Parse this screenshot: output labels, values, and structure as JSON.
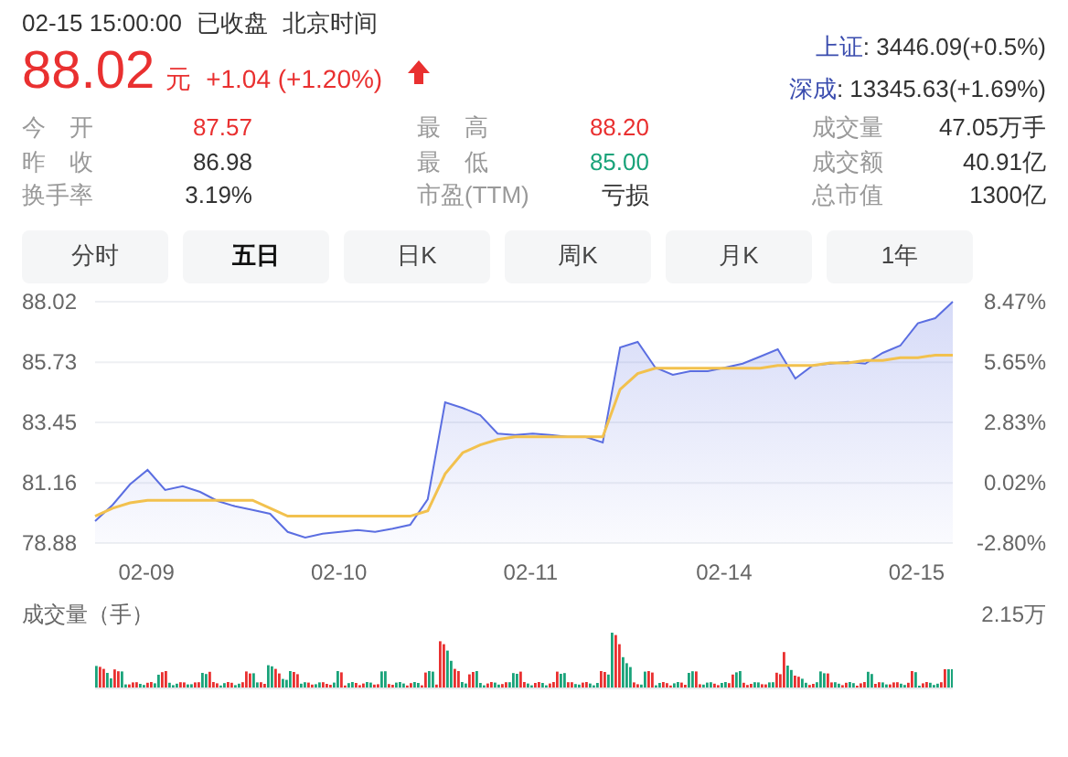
{
  "header": {
    "datetime": "02-15 15:00:00",
    "status": "已收盘",
    "timezone": "北京时间"
  },
  "price": {
    "value": "88.02",
    "unit": "元",
    "change": "+1.04 (+1.20%)",
    "rising": true
  },
  "indices": [
    {
      "name": "上证",
      "value": ": 3446.09(+0.5%)"
    },
    {
      "name": "深成",
      "value": ": 13345.63(+1.69%)"
    }
  ],
  "stats": [
    {
      "label": "今　开",
      "value": "87.57",
      "color": "#e93030"
    },
    {
      "label": "最　高",
      "value": "88.20",
      "color": "#e93030"
    },
    {
      "label": "成交量",
      "value": "47.05万手",
      "color": "#333333"
    },
    {
      "label": "昨　收",
      "value": "86.98",
      "color": "#333333"
    },
    {
      "label": "最　低",
      "value": "85.00",
      "color": "#1aa37a"
    },
    {
      "label": "成交额",
      "value": "40.91亿",
      "color": "#333333"
    },
    {
      "label": "换手率",
      "value": "3.19%",
      "color": "#333333"
    },
    {
      "label": "市盈(TTM)",
      "value": "亏损",
      "color": "#333333"
    },
    {
      "label": "总市值",
      "value": "1300亿",
      "color": "#333333"
    }
  ],
  "tabs": [
    {
      "label": "分时",
      "selected": false
    },
    {
      "label": "五日",
      "selected": true
    },
    {
      "label": "日K",
      "selected": false
    },
    {
      "label": "周K",
      "selected": false
    },
    {
      "label": "月K",
      "selected": false
    },
    {
      "label": "1年",
      "selected": false
    }
  ],
  "price_chart": {
    "right_axis": [
      "8.47%",
      "5.65%",
      "2.83%",
      "0.02%",
      "-2.80%"
    ],
    "chart_data": {
      "type": "area",
      "grid": true,
      "categories": [
        null,
        null,
        null,
        "02-09",
        null,
        null,
        null,
        null,
        null,
        null,
        null,
        null,
        null,
        null,
        "02-10",
        null,
        null,
        null,
        null,
        null,
        null,
        null,
        null,
        null,
        null,
        "02-11",
        null,
        null,
        null,
        null,
        null,
        null,
        null,
        null,
        null,
        null,
        "02-14",
        null,
        null,
        null,
        null,
        null,
        null,
        null,
        null,
        null,
        null,
        "02-15",
        null,
        null
      ],
      "ylim": [
        78.88,
        88.02
      ],
      "yticks": [
        {
          "value": 88.02,
          "label": "88.02"
        },
        {
          "value": 85.73,
          "label": "85.73"
        },
        {
          "value": 83.45,
          "label": "83.45"
        },
        {
          "value": 81.16,
          "label": "81.16"
        },
        {
          "value": 78.88,
          "label": "78.88"
        }
      ],
      "series": [
        {
          "type": "area",
          "color": "#5b6ee1",
          "values": [
            79.71,
            80.33,
            81.1,
            81.65,
            80.89,
            81.03,
            80.82,
            80.47,
            80.27,
            80.13,
            79.99,
            79.3,
            79.09,
            79.23,
            79.3,
            79.37,
            79.3,
            79.43,
            79.57,
            80.54,
            84.21,
            84.0,
            83.73,
            83.03,
            82.97,
            83.03,
            82.97,
            82.9,
            82.9,
            82.69,
            86.29,
            86.5,
            85.53,
            85.25,
            85.39,
            85.39,
            85.53,
            85.67,
            85.94,
            86.22,
            85.11,
            85.6,
            85.67,
            85.74,
            85.67,
            86.08,
            86.36,
            87.2,
            87.4,
            88.02
          ]
        },
        {
          "type": "line",
          "color": "#f2c14e",
          "values": [
            79.9,
            80.2,
            80.4,
            80.5,
            80.5,
            80.5,
            80.5,
            80.5,
            80.5,
            80.5,
            80.2,
            79.9,
            79.9,
            79.9,
            79.9,
            79.9,
            79.9,
            79.9,
            79.9,
            80.1,
            81.5,
            82.3,
            82.6,
            82.8,
            82.9,
            82.9,
            82.9,
            82.9,
            82.9,
            82.9,
            84.7,
            85.3,
            85.5,
            85.5,
            85.5,
            85.5,
            85.5,
            85.5,
            85.5,
            85.6,
            85.6,
            85.6,
            85.7,
            85.7,
            85.8,
            85.8,
            85.9,
            85.9,
            86.0,
            86.0
          ]
        }
      ]
    }
  },
  "volume_chart": {
    "title": "成交量（手）",
    "max_label": "2.15万"
  }
}
